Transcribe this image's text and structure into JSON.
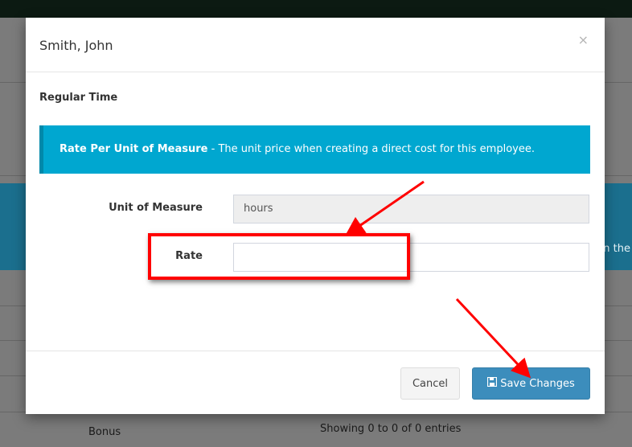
{
  "background": {
    "blue_band_text": "n the",
    "bottom_row": {
      "col1": "Bonus",
      "col2": "Showing 0 to 0 of 0 entries"
    }
  },
  "modal": {
    "title": "Smith, John",
    "close_glyph": "×",
    "section_title": "Regular Time",
    "callout": {
      "strong": "Rate Per Unit of Measure",
      "text": " - The unit price when creating a direct cost for this employee."
    },
    "fields": {
      "unit_of_measure": {
        "label": "Unit of Measure",
        "value": "hours"
      },
      "rate": {
        "label": "Rate",
        "value": ""
      }
    },
    "footer": {
      "cancel_label": "Cancel",
      "save_label": "Save Changes",
      "save_icon": "floppy-disk-icon"
    }
  },
  "annotations": {
    "highlight_color": "#ff0000",
    "arrow_color": "#ff0000"
  }
}
